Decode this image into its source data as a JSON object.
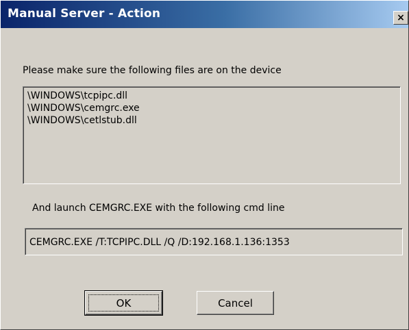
{
  "window": {
    "title": "Manual Server - Action",
    "close_glyph": "×"
  },
  "files_section": {
    "label": "Please make sure the following files are on the device",
    "files": [
      "\\WINDOWS\\tcpipc.dll",
      "\\WINDOWS\\cemgrc.exe",
      "\\WINDOWS\\cetlstub.dll"
    ]
  },
  "launch_section": {
    "label": "And launch CEMGRC.EXE with the following cmd line",
    "command": "CEMGRC.EXE /T:TCPIPC.DLL /Q  /D:192.168.1.136:1353"
  },
  "buttons": {
    "ok_label": "OK",
    "cancel_label": "Cancel"
  },
  "colors": {
    "face": "#d4d0c8",
    "title_start": "#0a246a",
    "title_end": "#a6caf0"
  },
  "icons": {
    "close": "close-icon"
  }
}
